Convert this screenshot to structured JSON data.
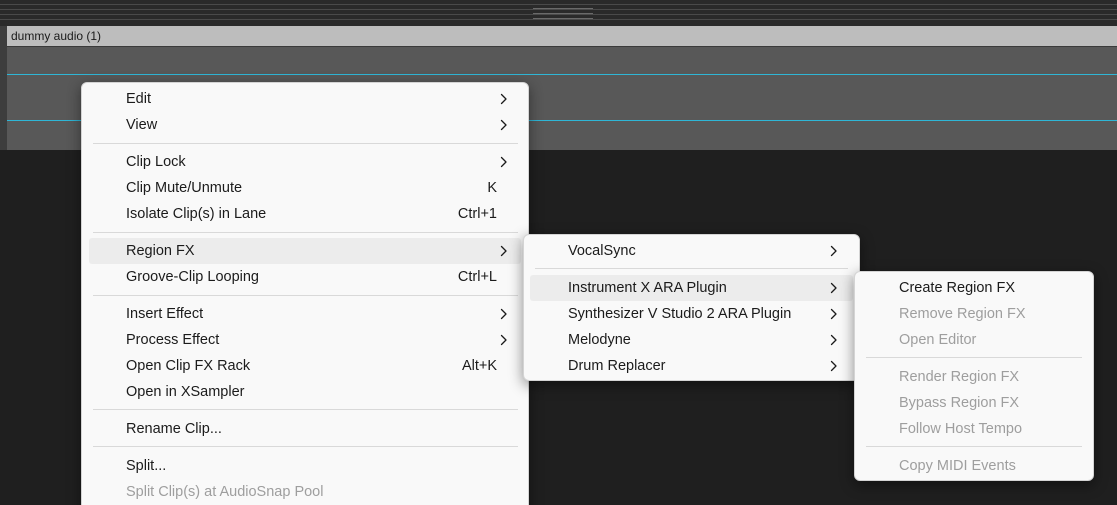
{
  "clip": {
    "title": "dummy audio (1)"
  },
  "colors": {
    "waveform_line": "#2fb6d6",
    "menu_bg": "#f9f9f9",
    "menu_text": "#1b1b1b",
    "menu_disabled_text": "#9e9e9e",
    "menu_hover": "#ececec"
  },
  "context_menu": {
    "items": [
      {
        "label": "Edit",
        "submenu": true
      },
      {
        "label": "View",
        "submenu": true
      },
      {
        "label": "Clip Lock",
        "submenu": true
      },
      {
        "label": "Clip Mute/Unmute",
        "shortcut": "K"
      },
      {
        "label": "Isolate Clip(s) in Lane",
        "shortcut": "Ctrl+1"
      },
      {
        "label": "Region FX",
        "submenu": true,
        "highlighted": true
      },
      {
        "label": "Groove-Clip Looping",
        "shortcut": "Ctrl+L"
      },
      {
        "label": "Insert Effect",
        "submenu": true
      },
      {
        "label": "Process Effect",
        "submenu": true
      },
      {
        "label": "Open Clip FX Rack",
        "shortcut": "Alt+K"
      },
      {
        "label": "Open in XSampler"
      },
      {
        "label": "Rename Clip..."
      },
      {
        "label": "Split..."
      },
      {
        "label": "Split Clip(s) at AudioSnap Pool",
        "disabled": true
      }
    ]
  },
  "region_fx_menu": {
    "items": [
      {
        "label": "VocalSync",
        "submenu": true
      },
      {
        "label": "Instrument X ARA Plugin",
        "submenu": true,
        "highlighted": true
      },
      {
        "label": "Synthesizer V Studio 2 ARA Plugin",
        "submenu": true
      },
      {
        "label": "Melodyne",
        "submenu": true
      },
      {
        "label": "Drum Replacer",
        "submenu": true
      }
    ]
  },
  "plugin_menu": {
    "items": [
      {
        "label": "Create Region FX"
      },
      {
        "label": "Remove Region FX",
        "disabled": true
      },
      {
        "label": "Open Editor",
        "disabled": true
      },
      {
        "label": "Render Region FX",
        "disabled": true
      },
      {
        "label": "Bypass Region FX",
        "disabled": true
      },
      {
        "label": "Follow Host Tempo",
        "disabled": true
      },
      {
        "label": "Copy MIDI Events",
        "disabled": true
      }
    ]
  }
}
